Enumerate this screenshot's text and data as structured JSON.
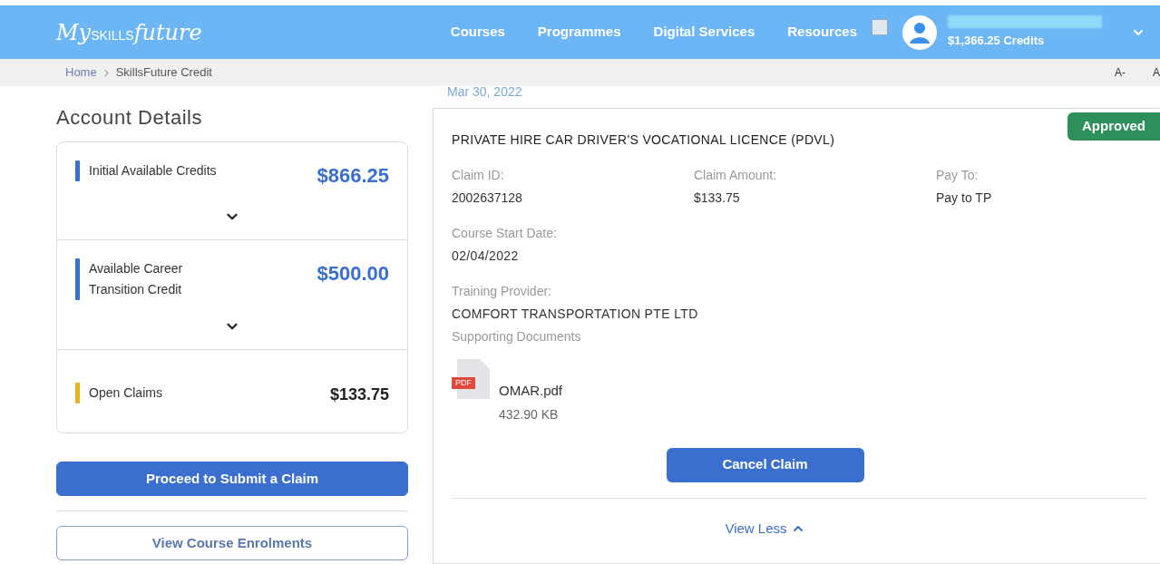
{
  "header": {
    "logo": [
      "My",
      "SKILLS",
      "future"
    ],
    "nav": [
      "Courses",
      "Programmes",
      "Digital Services",
      "Resources"
    ],
    "account": {
      "credits": "$1,366.25 Credits"
    }
  },
  "breadcrumb": [
    "Home",
    "SkillsFuture Credit"
  ],
  "font_size_controls": [
    "A-",
    "A"
  ],
  "account_details": {
    "title": "Account Details",
    "items": [
      {
        "label": "Initial Available Credits",
        "amount": "$866.25",
        "color": "#3a6fcf",
        "kind": "credit"
      },
      {
        "label": "Available Career Transition Credit",
        "amount": "$500.00",
        "color": "#3a6fcf",
        "kind": "credit"
      },
      {
        "label": "Open Claims",
        "amount": "$133.75",
        "color": "#e8b21c",
        "kind": "claims"
      }
    ],
    "buttons": [
      {
        "label": "Proceed to Submit a Claim",
        "kind": "primary"
      },
      {
        "label": "View Course Enrolments",
        "kind": "outline"
      }
    ]
  },
  "claim": {
    "date": "Mar 30, 2022",
    "status": "Approved",
    "title": "PRIVATE HIRE CAR DRIVER'S VOCATIONAL LICENCE (PDVL)",
    "fields": [
      {
        "label": "Claim ID:",
        "value": "2002637128"
      },
      {
        "label": "Claim Amount:",
        "value": "$133.75"
      },
      {
        "label": "Pay To:",
        "value": "Pay to TP"
      }
    ],
    "start_date": {
      "label": "Course Start Date:",
      "value": "02/04/2022"
    },
    "provider": {
      "label": "Training Provider:",
      "value": "COMFORT TRANSPORTATION PTE LTD"
    },
    "documents_label": "Supporting Documents",
    "document": {
      "badge": "PDF",
      "name": "OMAR.pdf",
      "size": "432.90 KB"
    },
    "cancel_button": "Cancel Claim",
    "view_less": "View Less"
  }
}
